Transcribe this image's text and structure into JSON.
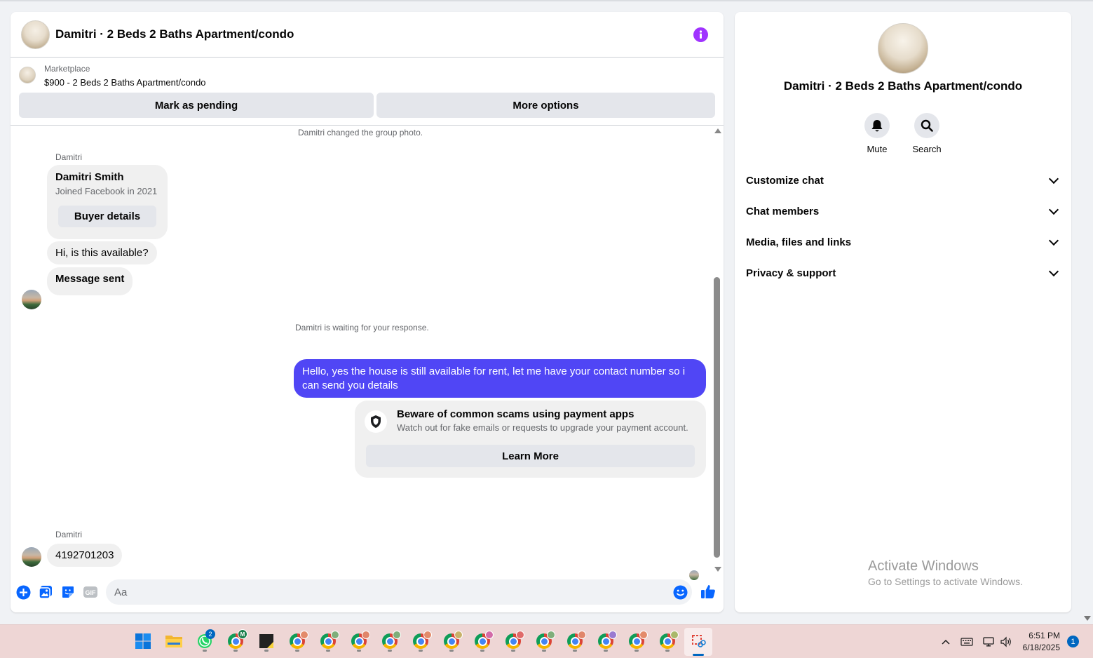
{
  "chat": {
    "title": "Damitri · 2 Beds 2 Baths Apartment/condo",
    "marketplace_label": "Marketplace",
    "listing": "$900 - 2 Beds 2 Baths Apartment/condo",
    "mark_pending_label": "Mark as pending",
    "more_options_label": "More options",
    "system_group_photo": "Damitri changed the group photo.",
    "sender_name": "Damitri",
    "profile_name": "Damitri Smith",
    "profile_joined": "Joined Facebook in 2021",
    "buyer_details_label": "Buyer details",
    "msg_available": "Hi, is this available?",
    "msg_sent": "Message sent",
    "system_waiting": "Damitri is waiting for your response.",
    "msg_outgoing": "Hello, yes the house is still available for rent, let me have your contact number so i can send you  details",
    "scam_title": "Beware of common scams using payment apps",
    "scam_desc": "Watch out for fake emails or requests to upgrade your payment account.",
    "learn_more_label": "Learn More",
    "sender_name_2": "Damitri",
    "msg_phone": "4192701203",
    "composer_placeholder": "Aa"
  },
  "details": {
    "title": "Damitri · 2 Beds 2 Baths Apartment/condo",
    "mute_label": "Mute",
    "search_label": "Search",
    "sections": [
      "Customize chat",
      "Chat members",
      "Media, files and links",
      "Privacy & support"
    ]
  },
  "watermark": {
    "line1": "Activate Windows",
    "line2": "Go to Settings to activate Windows."
  },
  "taskbar": {
    "whatsapp_badge": "2",
    "meet_badge": "M",
    "time": "6:51 PM",
    "date": "6/18/2025",
    "notification_count": "1"
  },
  "colors": {
    "accent": "#5046f5",
    "info": "#a033ff",
    "messenger_blue": "#0866ff"
  }
}
